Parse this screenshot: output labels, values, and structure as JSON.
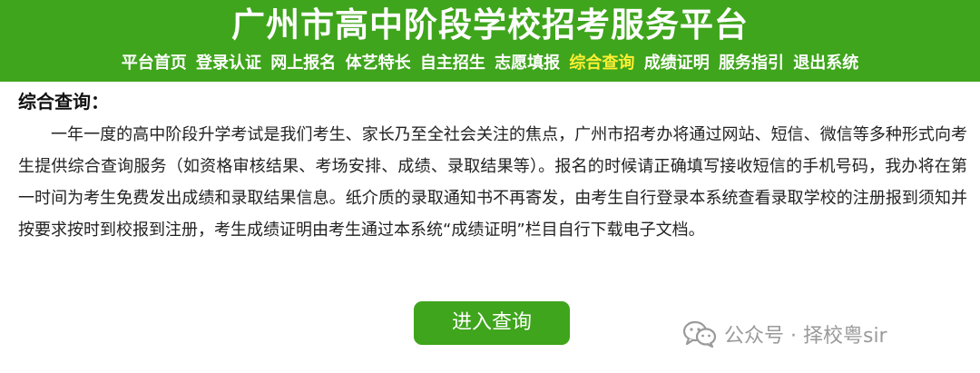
{
  "header": {
    "title": "广州市高中阶段学校招考服务平台",
    "nav": [
      {
        "label": "平台首页",
        "active": false
      },
      {
        "label": "登录认证",
        "active": false
      },
      {
        "label": "网上报名",
        "active": false
      },
      {
        "label": "体艺特长",
        "active": false
      },
      {
        "label": "自主招生",
        "active": false
      },
      {
        "label": "志愿填报",
        "active": false
      },
      {
        "label": "综合查询",
        "active": true
      },
      {
        "label": "成绩证明",
        "active": false
      },
      {
        "label": "服务指引",
        "active": false
      },
      {
        "label": "退出系统",
        "active": false
      }
    ]
  },
  "main": {
    "section_title": "综合查询：",
    "intro": "一年一度的高中阶段升学考试是我们考生、家长乃至全社会关注的焦点，广州市招考办将通过网站、短信、微信等多种形式向考生提供综合查询服务（如资格审核结果、考场安排、成绩、录取结果等）。报名的时候请正确填写接收短信的手机号码，我办将在第一时间为考生免费发出成绩和录取结果信息。纸介质的录取通知书不再寄发，由考生自行登录本系统查看录取学校的注册报到须知并按要求按时到校报到注册，考生成绩证明由考生通过本系统“成绩证明”栏目自行下载电子文档。",
    "query_button": "进入查询"
  },
  "watermark": {
    "text": "公众号 · 择校粤sir",
    "icon": "wechat-icon"
  },
  "colors": {
    "brand_green": "#3fa51c",
    "nav_active": "#ffef33",
    "watermark": "#9a9a9a"
  }
}
